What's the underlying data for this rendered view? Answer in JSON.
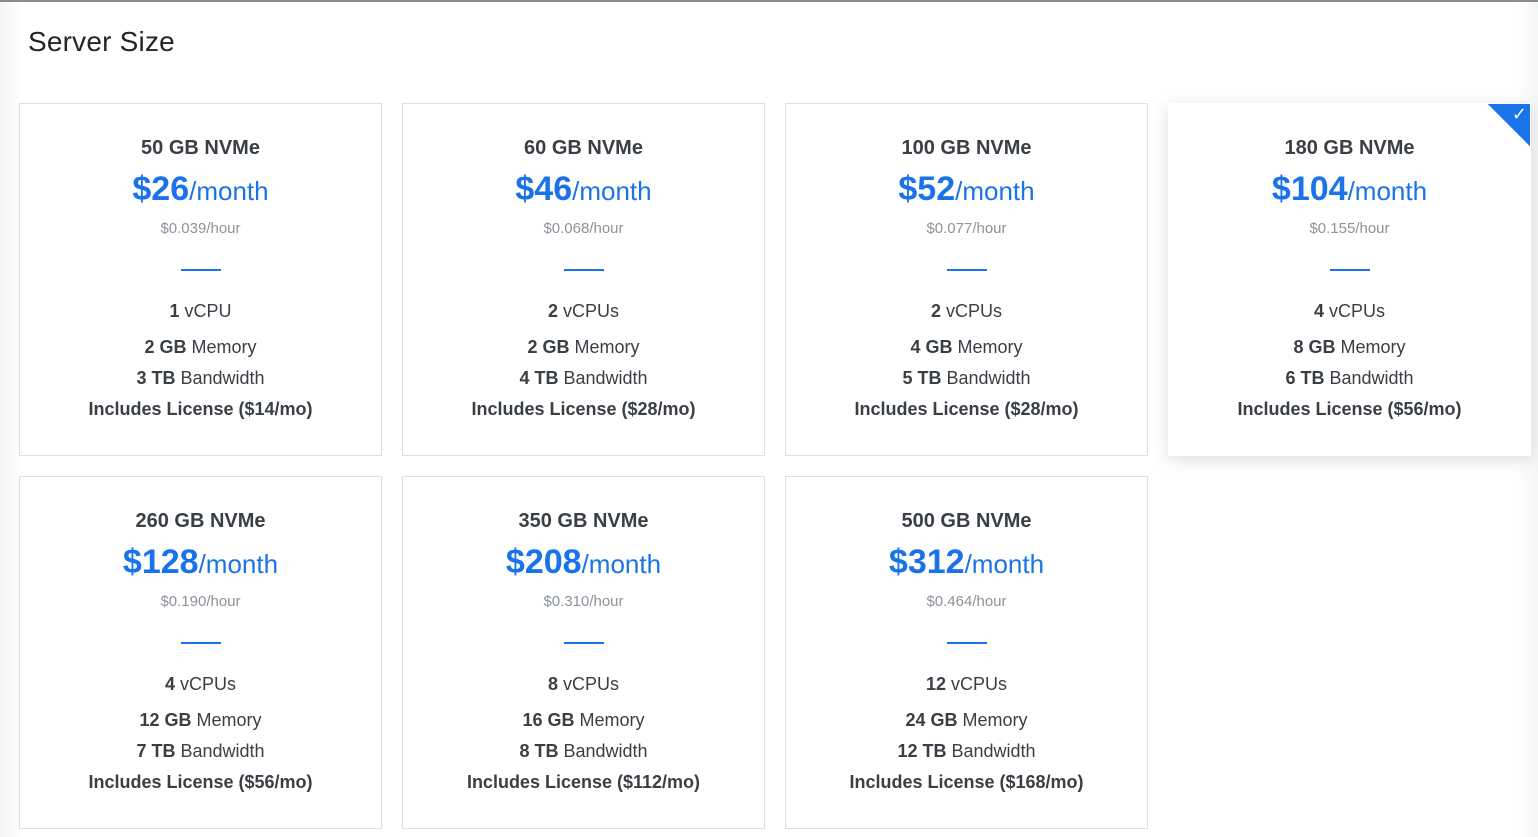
{
  "page": {
    "title": "Server Size"
  },
  "theme": {
    "accent": "#1a73e8",
    "muted": "#8c939a",
    "text": "#3a3f45"
  },
  "plans": [
    {
      "disk": "50 GB NVMe",
      "price": "$26",
      "unit": "/month",
      "hourly": "$0.039/hour",
      "cpu_num": "1",
      "cpu_label": "vCPU",
      "mem_num": "2 GB",
      "mem_label": "Memory",
      "bw_num": "3 TB",
      "bw_label": "Bandwidth",
      "license": "Includes License ($14/mo)",
      "selected": false
    },
    {
      "disk": "60 GB NVMe",
      "price": "$46",
      "unit": "/month",
      "hourly": "$0.068/hour",
      "cpu_num": "2",
      "cpu_label": "vCPUs",
      "mem_num": "2 GB",
      "mem_label": "Memory",
      "bw_num": "4 TB",
      "bw_label": "Bandwidth",
      "license": "Includes License ($28/mo)",
      "selected": false
    },
    {
      "disk": "100 GB NVMe",
      "price": "$52",
      "unit": "/month",
      "hourly": "$0.077/hour",
      "cpu_num": "2",
      "cpu_label": "vCPUs",
      "mem_num": "4 GB",
      "mem_label": "Memory",
      "bw_num": "5 TB",
      "bw_label": "Bandwidth",
      "license": "Includes License ($28/mo)",
      "selected": false
    },
    {
      "disk": "180 GB NVMe",
      "price": "$104",
      "unit": "/month",
      "hourly": "$0.155/hour",
      "cpu_num": "4",
      "cpu_label": "vCPUs",
      "mem_num": "8 GB",
      "mem_label": "Memory",
      "bw_num": "6 TB",
      "bw_label": "Bandwidth",
      "license": "Includes License ($56/mo)",
      "selected": true,
      "check_icon": "checkmark-icon"
    },
    {
      "disk": "260 GB NVMe",
      "price": "$128",
      "unit": "/month",
      "hourly": "$0.190/hour",
      "cpu_num": "4",
      "cpu_label": "vCPUs",
      "mem_num": "12 GB",
      "mem_label": "Memory",
      "bw_num": "7 TB",
      "bw_label": "Bandwidth",
      "license": "Includes License ($56/mo)",
      "selected": false
    },
    {
      "disk": "350 GB NVMe",
      "price": "$208",
      "unit": "/month",
      "hourly": "$0.310/hour",
      "cpu_num": "8",
      "cpu_label": "vCPUs",
      "mem_num": "16 GB",
      "mem_label": "Memory",
      "bw_num": "8 TB",
      "bw_label": "Bandwidth",
      "license": "Includes License ($112/mo)",
      "selected": false
    },
    {
      "disk": "500 GB NVMe",
      "price": "$312",
      "unit": "/month",
      "hourly": "$0.464/hour",
      "cpu_num": "12",
      "cpu_label": "vCPUs",
      "mem_num": "24 GB",
      "mem_label": "Memory",
      "bw_num": "12 TB",
      "bw_label": "Bandwidth",
      "license": "Includes License ($168/mo)",
      "selected": false
    }
  ]
}
